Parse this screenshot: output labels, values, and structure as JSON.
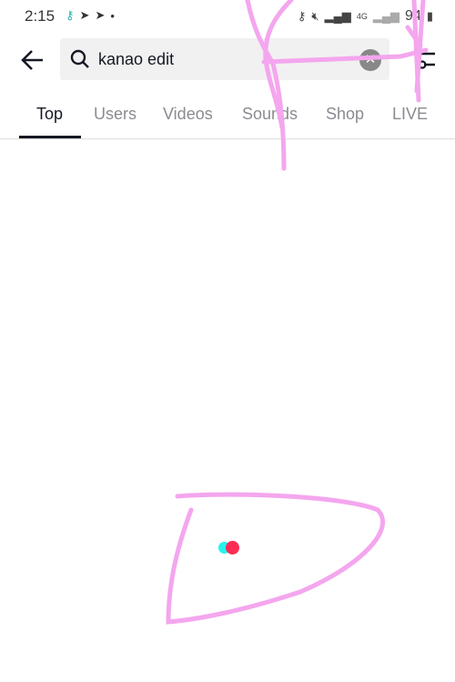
{
  "status_bar": {
    "time": "2:15",
    "battery": "94",
    "network": "4G"
  },
  "search": {
    "query": "kanao edit"
  },
  "tabs": [
    {
      "label": "Top",
      "active": true
    },
    {
      "label": "Users"
    },
    {
      "label": "Videos"
    },
    {
      "label": "Sounds"
    },
    {
      "label": "Shop"
    },
    {
      "label": "LIVE"
    }
  ],
  "colors": {
    "annotation": "#f4a6ee",
    "loader_cyan": "#25f4ee",
    "loader_red": "#fe2c55"
  },
  "icons": [
    "back-arrow-icon",
    "search-icon",
    "clear-icon",
    "filter-icon",
    "key-icon",
    "telegram-icon",
    "mute-icon",
    "signal-icon",
    "battery-icon"
  ]
}
